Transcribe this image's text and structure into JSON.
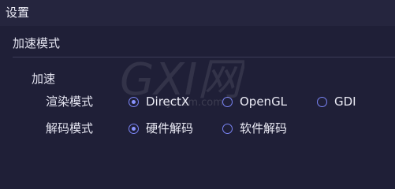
{
  "header": {
    "title": "设置"
  },
  "section": {
    "title": "加速模式"
  },
  "group": {
    "title": "加速"
  },
  "rows": [
    {
      "label": "渲染模式",
      "options": [
        {
          "label": "DirectX",
          "selected": true
        },
        {
          "label": "OpenGL",
          "selected": false
        },
        {
          "label": "GDI",
          "selected": false
        }
      ]
    },
    {
      "label": "解码模式",
      "options": [
        {
          "label": "硬件解码",
          "selected": true
        },
        {
          "label": "软件解码",
          "selected": false
        }
      ]
    }
  ],
  "watermark": {
    "logo_text": "GXI网",
    "url_text": "system.com"
  },
  "colors": {
    "background": "#1f1f37",
    "header_background": "#25253e",
    "accent": "#7a84f5",
    "text": "#e6e6f2",
    "divider": "#3b3b58"
  }
}
